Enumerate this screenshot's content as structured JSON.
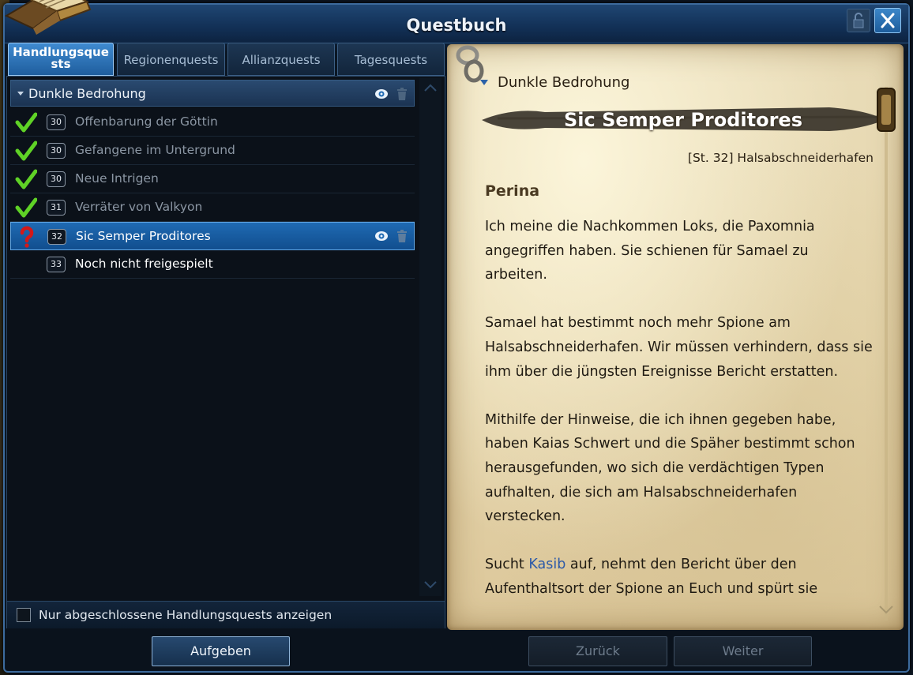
{
  "window": {
    "title": "Questbuch"
  },
  "tabs": [
    {
      "label": "Handlungsquests",
      "active": true
    },
    {
      "label": "Regionenquests",
      "active": false
    },
    {
      "label": "Allianzquests",
      "active": false
    },
    {
      "label": "Tagesquests",
      "active": false
    }
  ],
  "quest_group": {
    "name": "Dunkle Bedrohung"
  },
  "quests": [
    {
      "level": "30",
      "name": "Offenbarung der Göttin",
      "status": "complete"
    },
    {
      "level": "30",
      "name": "Gefangene im Untergrund",
      "status": "complete"
    },
    {
      "level": "30",
      "name": "Neue Intrigen",
      "status": "complete"
    },
    {
      "level": "31",
      "name": "Verräter von Valkyon",
      "status": "complete"
    },
    {
      "level": "32",
      "name": "Sic Semper Proditores",
      "status": "active",
      "selected": true
    },
    {
      "level": "33",
      "name": "Noch nicht freigespielt",
      "status": "locked"
    }
  ],
  "filter": {
    "label": "Nur abgeschlossene Handlungsquests anzeigen",
    "checked": false
  },
  "detail": {
    "group": "Dunkle Bedrohung",
    "title": "Sic Semper Proditores",
    "location": "[St. 32] Halsabschneiderhafen",
    "npc": "Perina",
    "paragraphs": [
      "Ich meine die Nachkommen Loks, die Paxomnia angegriffen haben. Sie schienen für Samael zu arbeiten.",
      "Samael hat bestimmt noch mehr Spione am Halsabschneiderhafen. Wir müssen verhindern, dass sie ihm über die jüngsten Ereignisse Bericht erstatten.",
      "Mithilfe der Hinweise, die ich ihnen gegeben habe, haben Kaias Schwert und die Späher bestimmt schon herausgefunden, wo sich die verdächtigen Typen aufhalten, die sich am Halsabschneiderhafen verstecken."
    ],
    "last_paragraph": {
      "before": "Sucht ",
      "link": "Kasib",
      "after": " auf, nehmt den Bericht über den Aufenthaltsort der Spione an Euch und spürt sie"
    }
  },
  "buttons": {
    "abandon": "Aufgeben",
    "back": "Zurück",
    "next": "Weiter"
  },
  "colors": {
    "accent": "#1f6ab3",
    "complete_check": "#5fd226",
    "active_marker": "#d41818",
    "link": "#2c5aa8"
  }
}
